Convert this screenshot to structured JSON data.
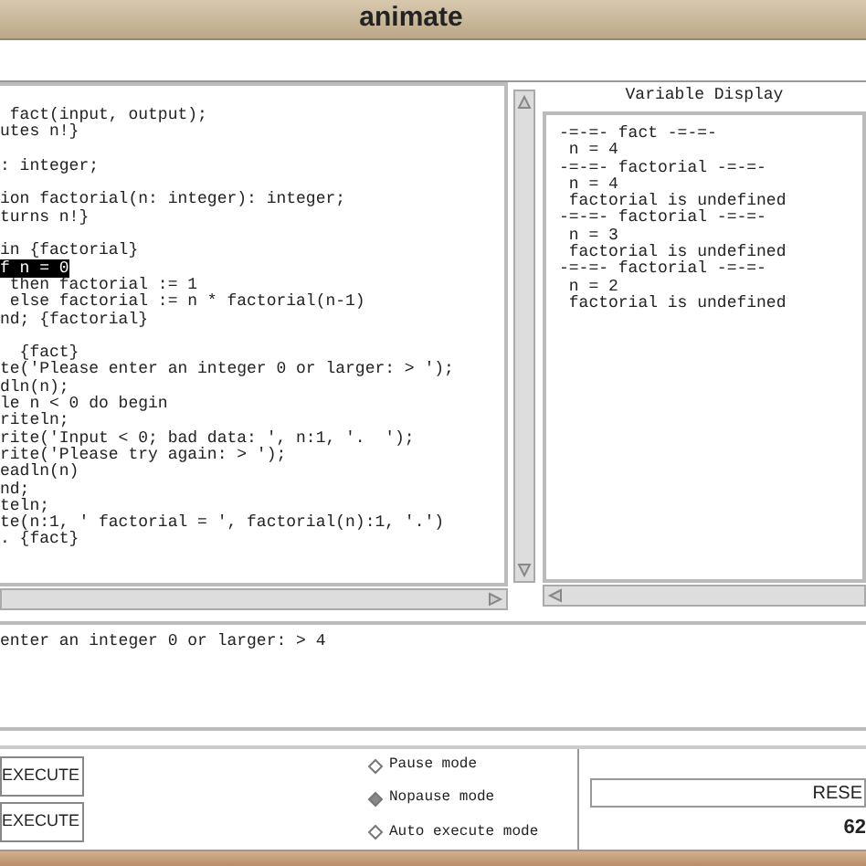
{
  "window": {
    "title": "animate"
  },
  "code_blocks": [
    [
      {
        "text": " fact(input, output);",
        "highlighted": false
      },
      {
        "text": "utes n!}",
        "highlighted": false
      }
    ],
    [
      {
        "text": ": integer;",
        "highlighted": false
      }
    ],
    [
      {
        "text": "ion factorial(n: integer): integer;",
        "highlighted": false
      },
      {
        "text": "turns n!}",
        "highlighted": false
      }
    ],
    [
      {
        "text": "in {factorial}",
        "highlighted": false
      },
      {
        "text": "f n = 0",
        "highlighted": true
      },
      {
        "text": " then factorial := 1",
        "highlighted": false
      },
      {
        "text": " else factorial := n * factorial(n-1)",
        "highlighted": false
      },
      {
        "text": "nd; {factorial}",
        "highlighted": false
      }
    ],
    [
      {
        "text": "  {fact}",
        "highlighted": false
      },
      {
        "text": "te('Please enter an integer 0 or larger: > ');",
        "highlighted": false
      },
      {
        "text": "dln(n);",
        "highlighted": false
      },
      {
        "text": "le n < 0 do begin",
        "highlighted": false
      },
      {
        "text": "riteln;",
        "highlighted": false
      },
      {
        "text": "rite('Input < 0; bad data: ', n:1, '.  ');",
        "highlighted": false
      },
      {
        "text": "rite('Please try again: > ');",
        "highlighted": false
      },
      {
        "text": "eadln(n)",
        "highlighted": false
      },
      {
        "text": "nd;",
        "highlighted": false
      },
      {
        "text": "teln;",
        "highlighted": false
      },
      {
        "text": "te(n:1, ' factorial = ', factorial(n):1, '.')",
        "highlighted": false
      },
      {
        "text": ". {fact}",
        "highlighted": false
      }
    ]
  ],
  "variable_display": {
    "title": "Variable Display",
    "lines": [
      "-=-=- fact -=-=-",
      " n = 4",
      "-=-=- factorial -=-=-",
      " n = 4",
      " factorial is undefined",
      "-=-=- factorial -=-=-",
      " n = 3",
      " factorial is undefined",
      "-=-=- factorial -=-=-",
      " n = 2",
      " factorial is undefined"
    ]
  },
  "console": {
    "lines": [
      "enter an integer 0 or larger: > 4"
    ]
  },
  "buttons": [
    "EXECUTE",
    "EXECUTE"
  ],
  "modes": [
    {
      "label": "Pause mode",
      "selected": false
    },
    {
      "label": "Nopause mode",
      "selected": true
    },
    {
      "label": "Auto execute mode",
      "selected": false
    }
  ],
  "reset_button": "RESE",
  "counter": "62"
}
